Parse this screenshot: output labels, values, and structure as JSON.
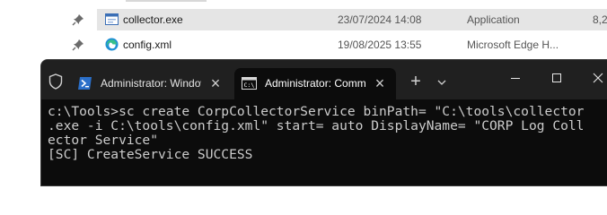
{
  "explorer": {
    "rows": [
      {
        "name": "collector.exe",
        "date": "23/07/2024 14:08",
        "type": "Application",
        "size": "8,2",
        "icon": "application-icon",
        "selected": true
      },
      {
        "name": "config.xml",
        "date": "19/08/2025 13:55",
        "type": "Microsoft Edge H...",
        "size": "",
        "icon": "edge-icon",
        "selected": false
      }
    ]
  },
  "terminal": {
    "tabs": [
      {
        "label": "Administrator: Windows PowerShell",
        "icon": "powershell-icon",
        "active": false
      },
      {
        "label": "Administrator: Command Prompt",
        "icon": "cmd-icon",
        "active": true
      }
    ],
    "new_tab": "+",
    "dropdown": "⌄",
    "lines": [
      "c:\\Tools>sc create CorpCollectorService binPath= \"C:\\tools\\collector",
      ".exe -i C:\\tools\\config.xml\" start= auto DisplayName= \"CORP Log Coll",
      "ector Service\"",
      "[SC] CreateService SUCCESS"
    ]
  },
  "colors": {
    "terminal_bg": "#0c0c0c",
    "tabbar_bg": "#202020",
    "text": "#cccccc",
    "selection": "#e5e5e5"
  }
}
